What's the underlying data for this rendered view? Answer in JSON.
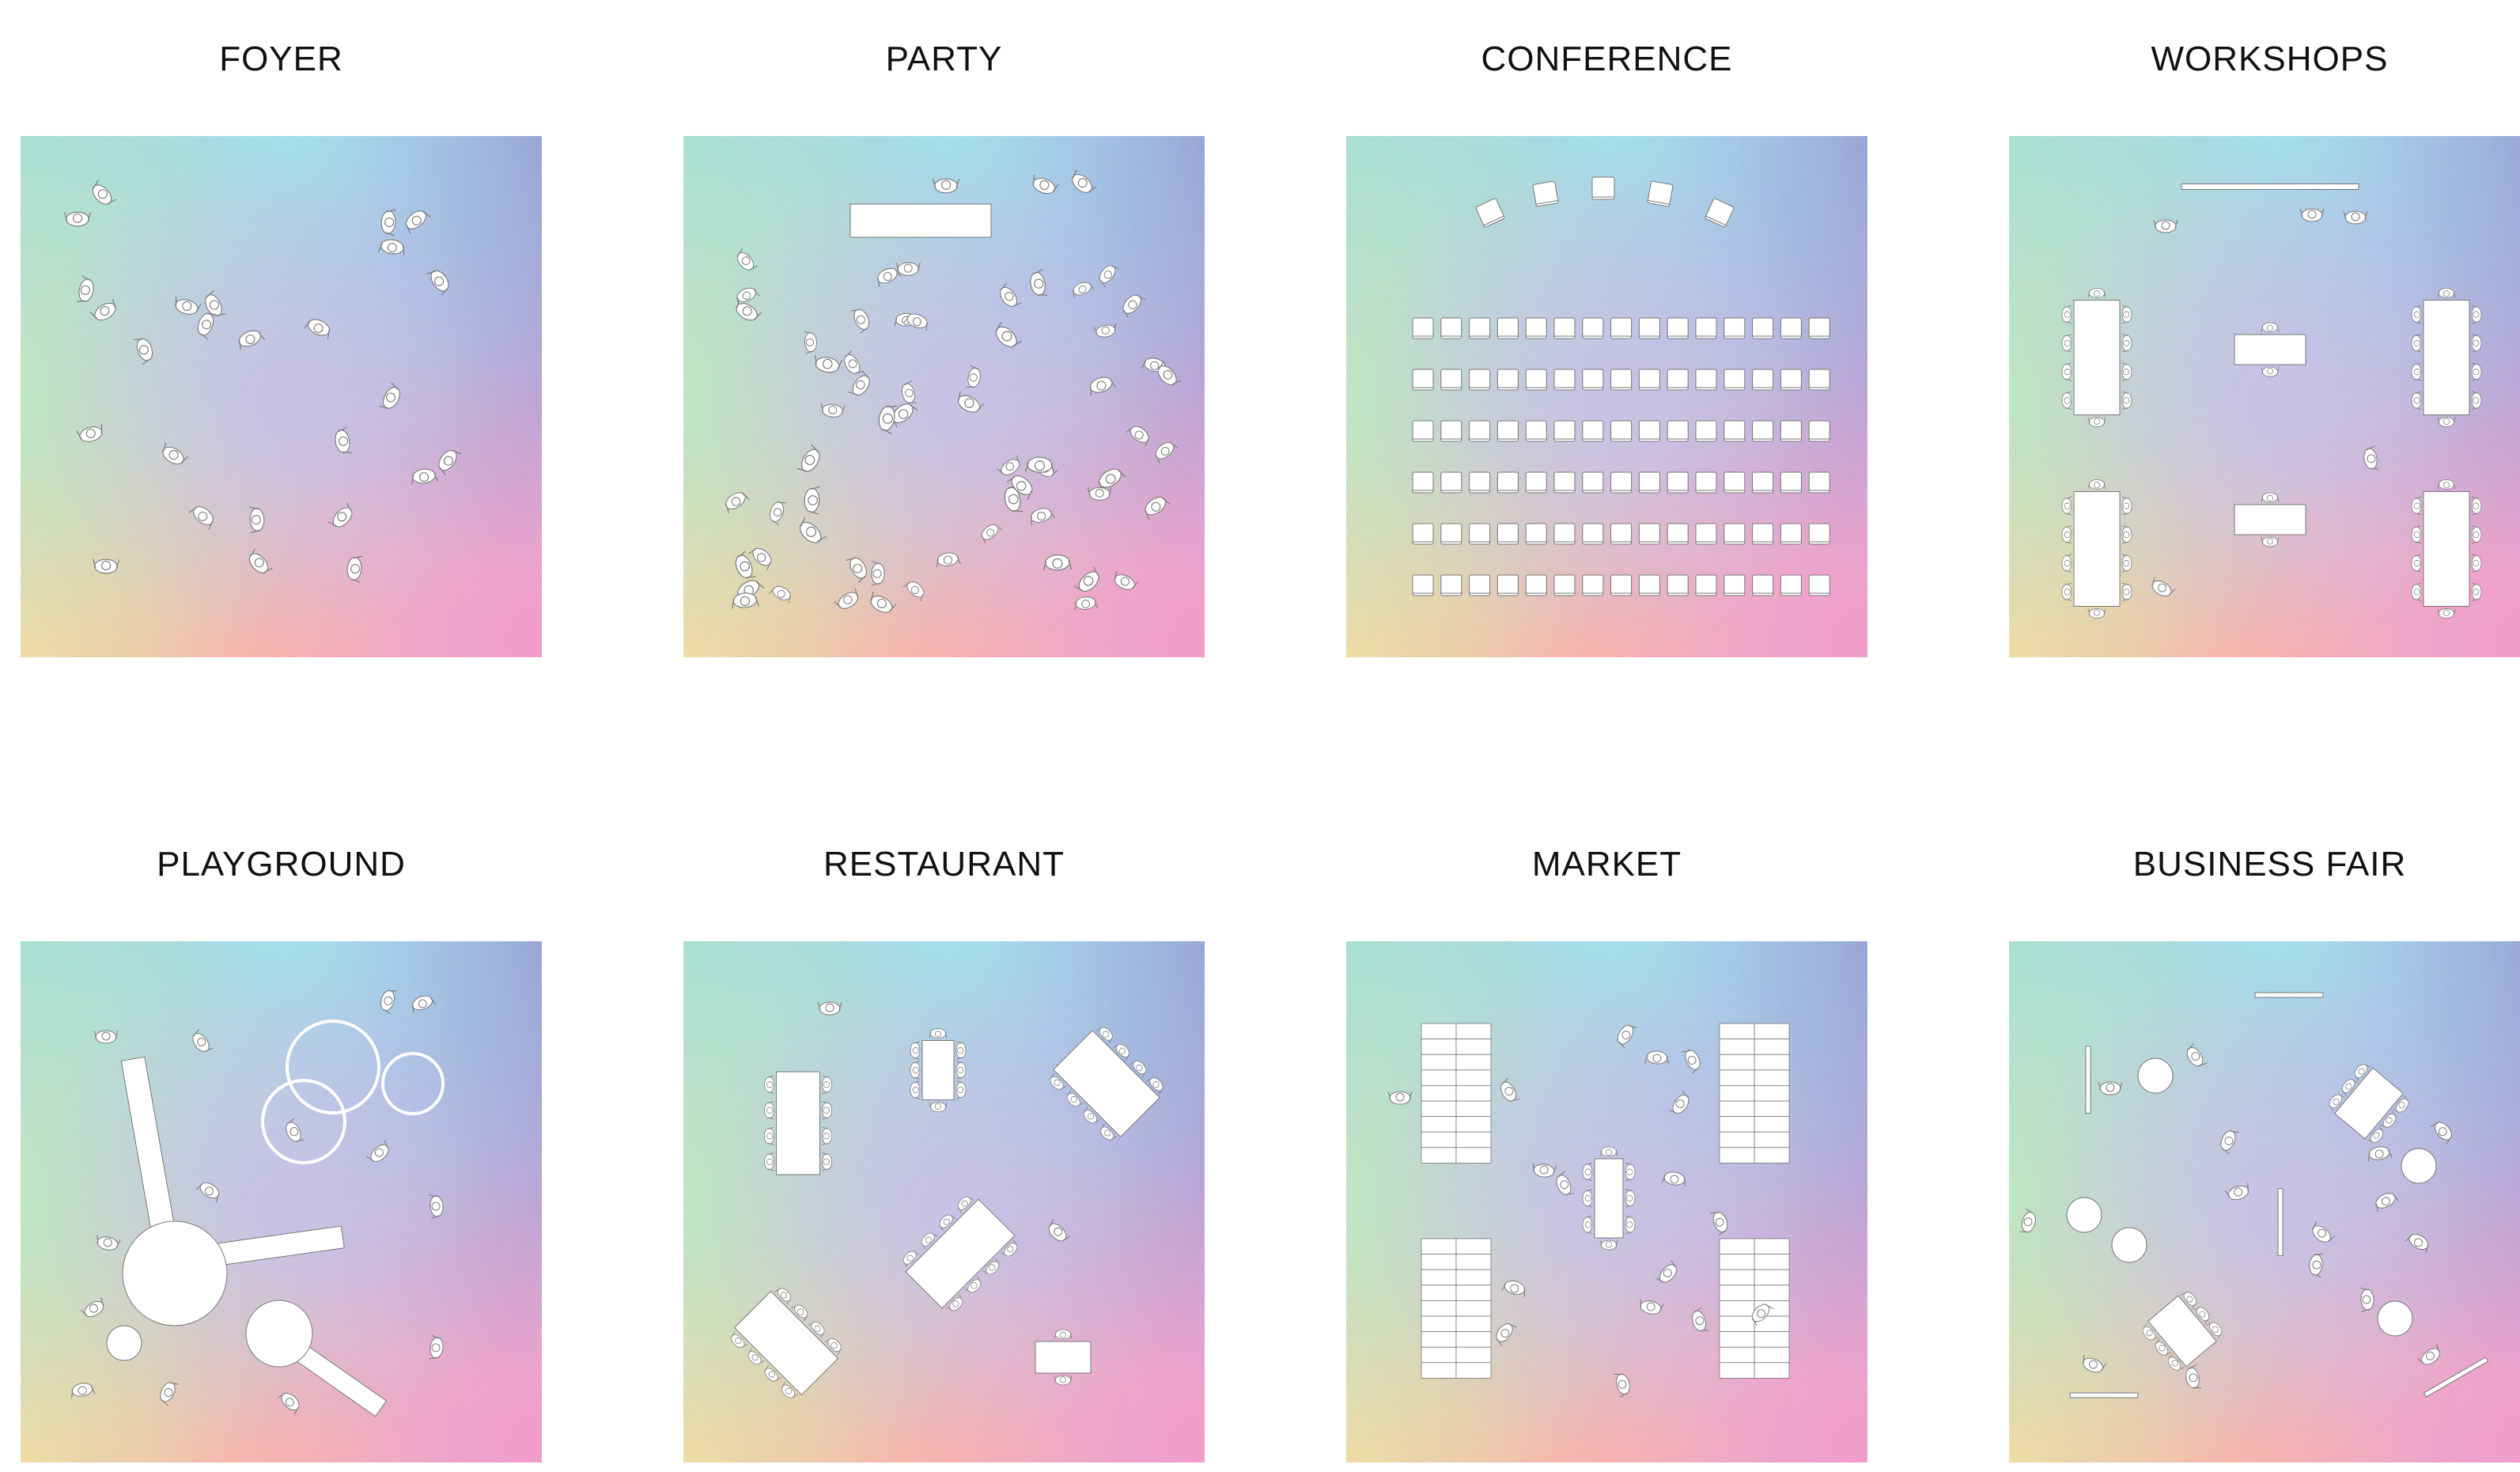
{
  "panels": [
    {
      "id": "foyer",
      "title": "FOYER"
    },
    {
      "id": "party",
      "title": "PARTY"
    },
    {
      "id": "conference",
      "title": "CONFERENCE"
    },
    {
      "id": "workshops",
      "title": "WORKSHOPS"
    },
    {
      "id": "playground",
      "title": "PLAYGROUND"
    },
    {
      "id": "restaurant",
      "title": "RESTAURANT"
    },
    {
      "id": "market",
      "title": "MARKET"
    },
    {
      "id": "business-fair",
      "title": "BUSINESS FAIR"
    }
  ],
  "gradient_colors": {
    "top_left": "#a3dfd6",
    "top_center": "#a4dff0",
    "top_right": "#958fcb",
    "mid_left": "#bfe6c2",
    "center": "#c8c2e6",
    "bottom_left": "#fde39a",
    "bottom_center": "#f9bfa1",
    "bottom_right": "#f29ccc",
    "furniture": "#ffffff",
    "outline": "#777777"
  }
}
